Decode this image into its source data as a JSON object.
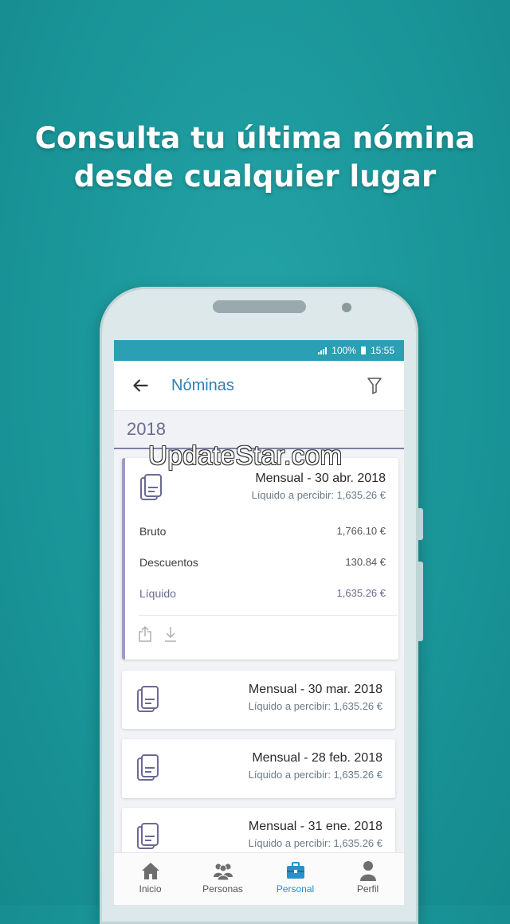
{
  "promo": {
    "headline_line1": "Consulta tu última nómina",
    "headline_line2": "desde cualquier lugar"
  },
  "watermark": "UpdateStar.com",
  "statusbar": {
    "battery": "100%",
    "time": "15:55"
  },
  "appbar": {
    "title": "Nóminas",
    "back_icon": "arrow-left-icon",
    "filter_icon": "filter-icon"
  },
  "year": "2018",
  "payslips": [
    {
      "period": "Mensual - 30 abr. 2018",
      "liquido_line": "Líquido a percibir: 1,635.26 €",
      "expanded": true,
      "details": [
        {
          "label": "Bruto",
          "value": "1,766.10 €"
        },
        {
          "label": "Descuentos",
          "value": "130.84 €"
        },
        {
          "label": "Líquido",
          "value": "1,635.26 €"
        }
      ],
      "actions": [
        "share-icon",
        "download-icon"
      ]
    },
    {
      "period": "Mensual - 30 mar. 2018",
      "liquido_line": "Líquido a percibir: 1,635.26 €"
    },
    {
      "period": "Mensual - 28 feb. 2018",
      "liquido_line": "Líquido a percibir: 1,635.26 €"
    },
    {
      "period": "Mensual - 31 ene. 2018",
      "liquido_line": "Líquido a percibir: 1,635.26 €"
    }
  ],
  "bottom_nav": [
    {
      "label": "Inicio",
      "icon": "home-icon",
      "active": false
    },
    {
      "label": "Personas",
      "icon": "people-icon",
      "active": false
    },
    {
      "label": "Personal",
      "icon": "briefcase-icon",
      "active": true
    },
    {
      "label": "Perfil",
      "icon": "person-icon",
      "active": false
    }
  ],
  "colors": {
    "background": "#1a9699",
    "accent": "#2b9fb4",
    "title": "#2f7fb3",
    "active_nav": "#2b8fc9",
    "year_text": "#6b6a92"
  }
}
